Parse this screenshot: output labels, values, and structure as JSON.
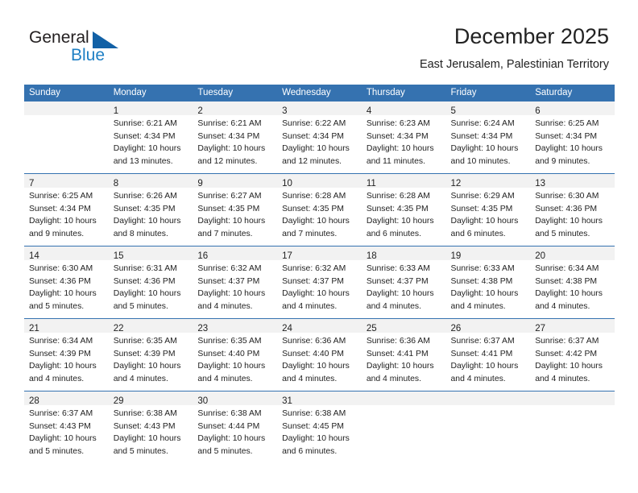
{
  "brand": {
    "word_one": "General",
    "word_two": "Blue",
    "triangle_color": "#1261a6",
    "blue_text_color": "#1e7fc4"
  },
  "header": {
    "month_title": "December 2025",
    "location": "East Jerusalem, Palestinian Territory"
  },
  "theme": {
    "header_band": "#3572b0",
    "daynum_band": "#f2f2f2",
    "text": "#222222"
  },
  "weekdays": [
    "Sunday",
    "Monday",
    "Tuesday",
    "Wednesday",
    "Thursday",
    "Friday",
    "Saturday"
  ],
  "weeks": [
    [
      {
        "day": "",
        "lines": []
      },
      {
        "day": "1",
        "lines": [
          "Sunrise: 6:21 AM",
          "Sunset: 4:34 PM",
          "Daylight: 10 hours",
          "and 13 minutes."
        ]
      },
      {
        "day": "2",
        "lines": [
          "Sunrise: 6:21 AM",
          "Sunset: 4:34 PM",
          "Daylight: 10 hours",
          "and 12 minutes."
        ]
      },
      {
        "day": "3",
        "lines": [
          "Sunrise: 6:22 AM",
          "Sunset: 4:34 PM",
          "Daylight: 10 hours",
          "and 12 minutes."
        ]
      },
      {
        "day": "4",
        "lines": [
          "Sunrise: 6:23 AM",
          "Sunset: 4:34 PM",
          "Daylight: 10 hours",
          "and 11 minutes."
        ]
      },
      {
        "day": "5",
        "lines": [
          "Sunrise: 6:24 AM",
          "Sunset: 4:34 PM",
          "Daylight: 10 hours",
          "and 10 minutes."
        ]
      },
      {
        "day": "6",
        "lines": [
          "Sunrise: 6:25 AM",
          "Sunset: 4:34 PM",
          "Daylight: 10 hours",
          "and 9 minutes."
        ]
      }
    ],
    [
      {
        "day": "7",
        "lines": [
          "Sunrise: 6:25 AM",
          "Sunset: 4:34 PM",
          "Daylight: 10 hours",
          "and 9 minutes."
        ]
      },
      {
        "day": "8",
        "lines": [
          "Sunrise: 6:26 AM",
          "Sunset: 4:35 PM",
          "Daylight: 10 hours",
          "and 8 minutes."
        ]
      },
      {
        "day": "9",
        "lines": [
          "Sunrise: 6:27 AM",
          "Sunset: 4:35 PM",
          "Daylight: 10 hours",
          "and 7 minutes."
        ]
      },
      {
        "day": "10",
        "lines": [
          "Sunrise: 6:28 AM",
          "Sunset: 4:35 PM",
          "Daylight: 10 hours",
          "and 7 minutes."
        ]
      },
      {
        "day": "11",
        "lines": [
          "Sunrise: 6:28 AM",
          "Sunset: 4:35 PM",
          "Daylight: 10 hours",
          "and 6 minutes."
        ]
      },
      {
        "day": "12",
        "lines": [
          "Sunrise: 6:29 AM",
          "Sunset: 4:35 PM",
          "Daylight: 10 hours",
          "and 6 minutes."
        ]
      },
      {
        "day": "13",
        "lines": [
          "Sunrise: 6:30 AM",
          "Sunset: 4:36 PM",
          "Daylight: 10 hours",
          "and 5 minutes."
        ]
      }
    ],
    [
      {
        "day": "14",
        "lines": [
          "Sunrise: 6:30 AM",
          "Sunset: 4:36 PM",
          "Daylight: 10 hours",
          "and 5 minutes."
        ]
      },
      {
        "day": "15",
        "lines": [
          "Sunrise: 6:31 AM",
          "Sunset: 4:36 PM",
          "Daylight: 10 hours",
          "and 5 minutes."
        ]
      },
      {
        "day": "16",
        "lines": [
          "Sunrise: 6:32 AM",
          "Sunset: 4:37 PM",
          "Daylight: 10 hours",
          "and 4 minutes."
        ]
      },
      {
        "day": "17",
        "lines": [
          "Sunrise: 6:32 AM",
          "Sunset: 4:37 PM",
          "Daylight: 10 hours",
          "and 4 minutes."
        ]
      },
      {
        "day": "18",
        "lines": [
          "Sunrise: 6:33 AM",
          "Sunset: 4:37 PM",
          "Daylight: 10 hours",
          "and 4 minutes."
        ]
      },
      {
        "day": "19",
        "lines": [
          "Sunrise: 6:33 AM",
          "Sunset: 4:38 PM",
          "Daylight: 10 hours",
          "and 4 minutes."
        ]
      },
      {
        "day": "20",
        "lines": [
          "Sunrise: 6:34 AM",
          "Sunset: 4:38 PM",
          "Daylight: 10 hours",
          "and 4 minutes."
        ]
      }
    ],
    [
      {
        "day": "21",
        "lines": [
          "Sunrise: 6:34 AM",
          "Sunset: 4:39 PM",
          "Daylight: 10 hours",
          "and 4 minutes."
        ]
      },
      {
        "day": "22",
        "lines": [
          "Sunrise: 6:35 AM",
          "Sunset: 4:39 PM",
          "Daylight: 10 hours",
          "and 4 minutes."
        ]
      },
      {
        "day": "23",
        "lines": [
          "Sunrise: 6:35 AM",
          "Sunset: 4:40 PM",
          "Daylight: 10 hours",
          "and 4 minutes."
        ]
      },
      {
        "day": "24",
        "lines": [
          "Sunrise: 6:36 AM",
          "Sunset: 4:40 PM",
          "Daylight: 10 hours",
          "and 4 minutes."
        ]
      },
      {
        "day": "25",
        "lines": [
          "Sunrise: 6:36 AM",
          "Sunset: 4:41 PM",
          "Daylight: 10 hours",
          "and 4 minutes."
        ]
      },
      {
        "day": "26",
        "lines": [
          "Sunrise: 6:37 AM",
          "Sunset: 4:41 PM",
          "Daylight: 10 hours",
          "and 4 minutes."
        ]
      },
      {
        "day": "27",
        "lines": [
          "Sunrise: 6:37 AM",
          "Sunset: 4:42 PM",
          "Daylight: 10 hours",
          "and 4 minutes."
        ]
      }
    ],
    [
      {
        "day": "28",
        "lines": [
          "Sunrise: 6:37 AM",
          "Sunset: 4:43 PM",
          "Daylight: 10 hours",
          "and 5 minutes."
        ]
      },
      {
        "day": "29",
        "lines": [
          "Sunrise: 6:38 AM",
          "Sunset: 4:43 PM",
          "Daylight: 10 hours",
          "and 5 minutes."
        ]
      },
      {
        "day": "30",
        "lines": [
          "Sunrise: 6:38 AM",
          "Sunset: 4:44 PM",
          "Daylight: 10 hours",
          "and 5 minutes."
        ]
      },
      {
        "day": "31",
        "lines": [
          "Sunrise: 6:38 AM",
          "Sunset: 4:45 PM",
          "Daylight: 10 hours",
          "and 6 minutes."
        ]
      },
      {
        "day": "",
        "lines": []
      },
      {
        "day": "",
        "lines": []
      },
      {
        "day": "",
        "lines": []
      }
    ]
  ]
}
